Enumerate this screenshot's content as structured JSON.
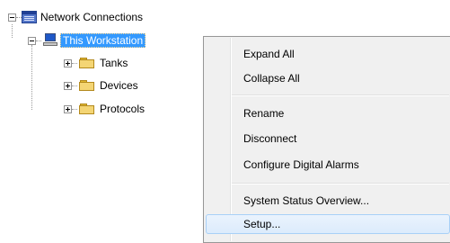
{
  "tree": {
    "root": {
      "label": "Network Connections",
      "icon": "network-connections-icon"
    },
    "workstation": {
      "label": "This Workstation",
      "icon": "computer-icon",
      "selected": true
    },
    "children": [
      {
        "label": "Tanks",
        "icon": "folder-icon"
      },
      {
        "label": "Devices",
        "icon": "folder-icon"
      },
      {
        "label": "Protocols",
        "icon": "folder-icon"
      }
    ]
  },
  "context_menu": {
    "items": [
      {
        "label": "Expand All"
      },
      {
        "label": "Collapse All"
      },
      {
        "label": "Rename"
      },
      {
        "label": "Disconnect"
      },
      {
        "label": "Configure Digital Alarms"
      },
      {
        "label": "System Status Overview..."
      },
      {
        "label": "Setup...",
        "highlighted": true
      }
    ]
  }
}
